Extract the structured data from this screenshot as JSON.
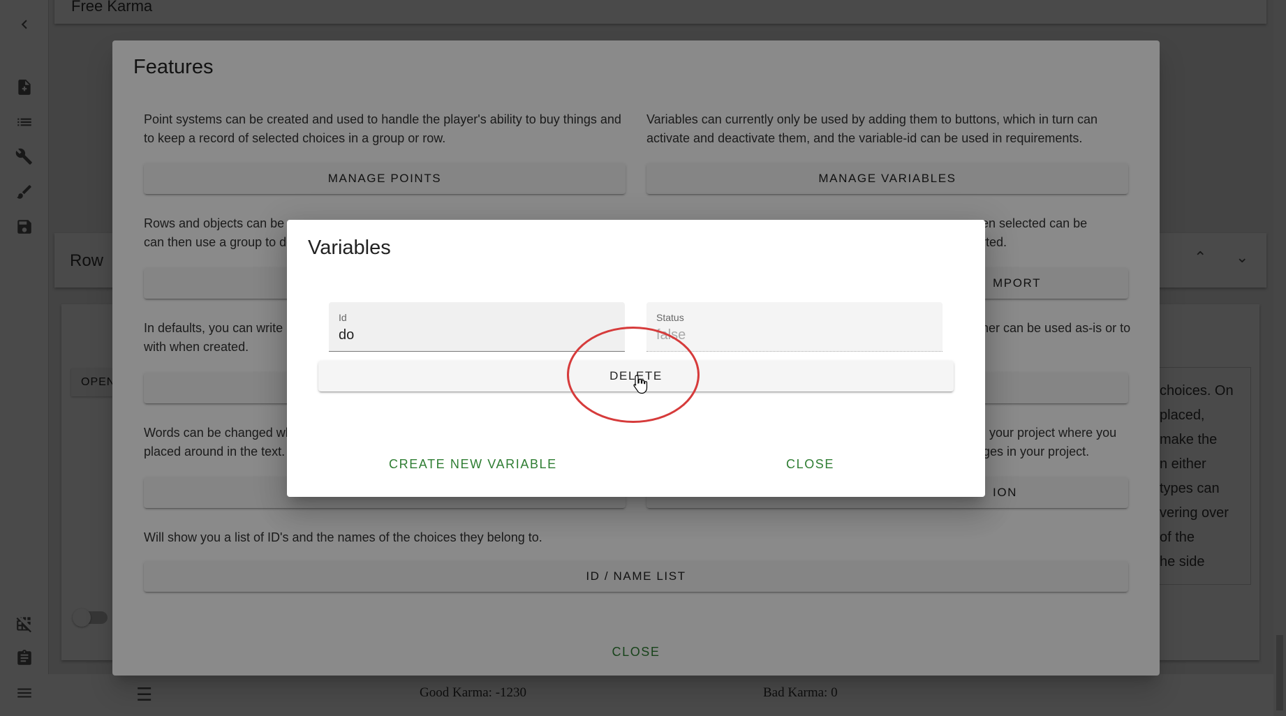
{
  "background": {
    "top_card_title": "Free Karma",
    "row_card_title": "Row",
    "open_button_label": "OPEN",
    "textarea_lines": [
      "choices. On",
      "placed,",
      "make the",
      "n either",
      "types can",
      "vering over",
      "of the",
      "he side"
    ],
    "good_karma": "Good Karma: -1230",
    "bad_karma": "Bad Karma: 0",
    "sidebar_icons": [
      "chevron-left-icon",
      "new-file-icon",
      "list-icon",
      "tools-icon",
      "brush-icon",
      "save-icon",
      "grid-off-icon",
      "clipboard-icon",
      "menu-icon"
    ]
  },
  "features_dialog": {
    "title": "Features",
    "sections": [
      {
        "desc": "Point systems can be created and used to handle the player's ability to buy things and to keep a record of selected choices in a group or row.",
        "button": "MANAGE POINTS"
      },
      {
        "desc": "Variables can currently only be used by adding them to buttons, which in turn can activate and deactivate them, and the variable-id can be used in requirements.",
        "button": "MANAGE VARIABLES"
      },
      {
        "desc": "Rows and objects can be a",
        "desc2": "can then use a group to de",
        "button": ""
      },
      {
        "desc": "en selected can be",
        "desc2": "rted.",
        "button": "MPORT"
      },
      {
        "desc": "In defaults, you can write i",
        "desc2": "with when created.",
        "button": ""
      },
      {
        "desc": "ner can be used as-is or to",
        "button": ""
      },
      {
        "desc": "Words can be changed wh",
        "desc2": "placed around in the text.",
        "button": ""
      },
      {
        "desc": "in your project where you",
        "desc2": "ages in your project.",
        "button": "ION"
      },
      {
        "desc": "Will show you a list of ID's and the names of the choices they belong to.",
        "button": "ID / NAME LIST"
      }
    ],
    "close_label": "CLOSE"
  },
  "variables_dialog": {
    "title": "Variables",
    "id_label": "Id",
    "id_value": "do",
    "status_label": "Status",
    "status_value": "false",
    "delete_label": "DELETE",
    "create_label": "CREATE NEW VARIABLE",
    "close_label": "CLOSE"
  },
  "colors": {
    "accent_green": "#2e7d32",
    "annotation_red": "#d63b3b"
  }
}
